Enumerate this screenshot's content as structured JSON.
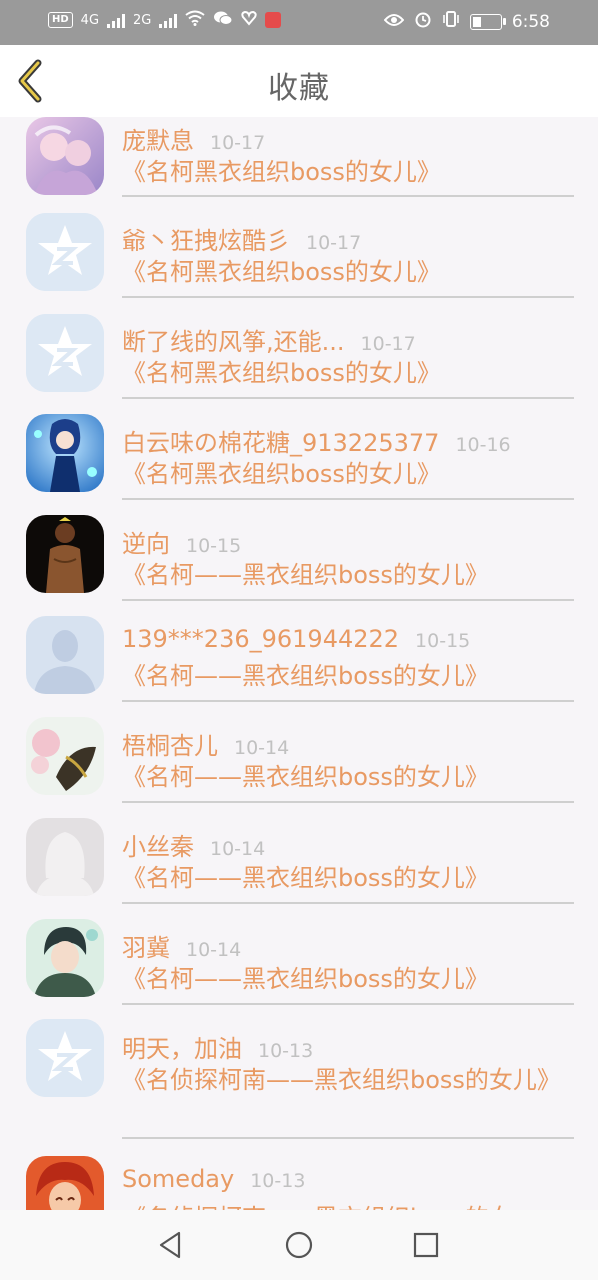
{
  "status_bar": {
    "left_chip": "HD",
    "net1": "4G",
    "net2": "2G",
    "time": "6:58"
  },
  "header": {
    "title": "收藏"
  },
  "items": [
    {
      "name": "庞默息",
      "date": "10-17",
      "ref": "《名柯黑衣组织boss的女儿》",
      "avatar": "anime-girls"
    },
    {
      "name": "爺丶狂拽炫酷彡",
      "date": "10-17",
      "ref": "《名柯黑衣组织boss的女儿》",
      "avatar": "qzone-default"
    },
    {
      "name": "断了线的风筝,还能...",
      "date": "10-17",
      "ref": "《名柯黑衣组织boss的女儿》",
      "avatar": "qzone-default"
    },
    {
      "name": "白云味の棉花糖_913225377",
      "date": "10-16",
      "ref": "《名柯黑衣组织boss的女儿》",
      "avatar": "blue-hair-girl"
    },
    {
      "name": "逆向",
      "date": "10-15",
      "ref": "《名柯——黑衣组织boss的女儿》",
      "avatar": "dark-figure"
    },
    {
      "name": "139***236_961944222",
      "date": "10-15",
      "ref": "《名柯——黑衣组织boss的女儿》",
      "avatar": "male-default"
    },
    {
      "name": "梧桐杏儿",
      "date": "10-14",
      "ref": "《名柯——黑衣组织boss的女儿》",
      "avatar": "flower-art"
    },
    {
      "name": "小丝秦",
      "date": "10-14",
      "ref": "《名柯——黑衣组织boss的女儿》",
      "avatar": "female-default"
    },
    {
      "name": "羽冀",
      "date": "10-14",
      "ref": "《名柯——黑衣组织boss的女儿》",
      "avatar": "anime-boy"
    },
    {
      "name": "明天，加油",
      "date": "10-13",
      "ref": "《名侦探柯南——黑衣组织boss的女儿》",
      "avatar": "qzone-default"
    },
    {
      "name": "Someday",
      "date": "10-13",
      "ref": "《名侦探柯南——黑衣组织boss的女",
      "avatar": "red-hair"
    }
  ],
  "colors": {
    "accent": "#e89a63",
    "date": "#c1c1c1",
    "status_bar": "#9a9a9a",
    "back_icon": "#c9a42a"
  }
}
